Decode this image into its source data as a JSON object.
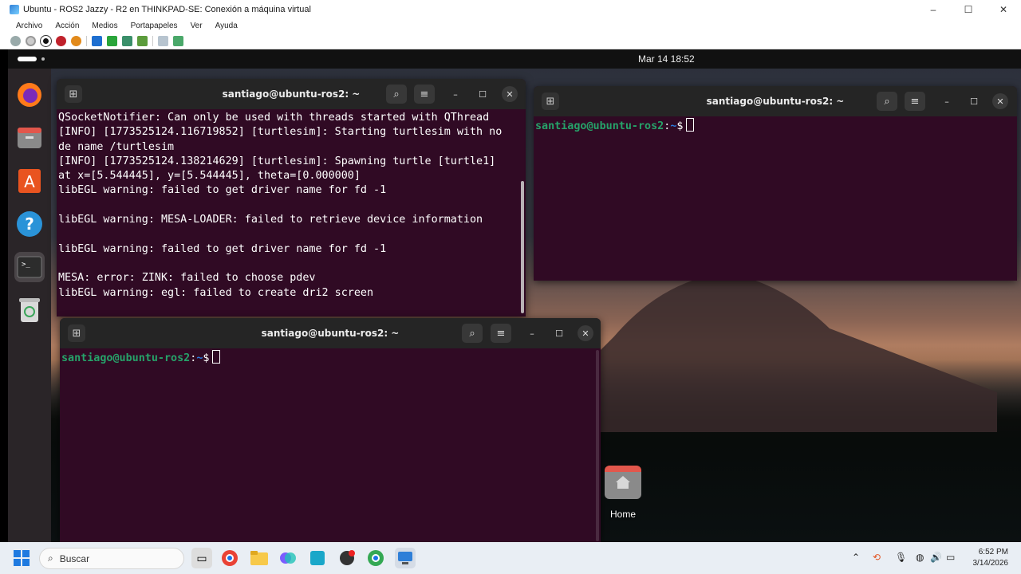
{
  "host": {
    "title": "Ubuntu - ROS2 Jazzy - R2 en THINKPAD-SE: Conexión a máquina virtual",
    "menu": [
      "Archivo",
      "Acción",
      "Medios",
      "Portapapeles",
      "Ver",
      "Ayuda"
    ],
    "window_controls": {
      "minimize": "–",
      "maximize": "☐",
      "close": "✕"
    }
  },
  "topbar": {
    "clock": "Mar 14  18:52"
  },
  "terminals": {
    "title": "santiago@ubuntu-ros2: ~",
    "t1_lines": [
      "QSocketNotifier: Can only be used with threads started with QThread",
      "[INFO] [1773525124.116719852] [turtlesim]: Starting turtlesim with no",
      "de name /turtlesim",
      "[INFO] [1773525124.138214629] [turtlesim]: Spawning turtle [turtle1]",
      "at x=[5.544445], y=[5.544445], theta=[0.000000]",
      "libEGL warning: failed to get driver name for fd -1",
      "",
      "libEGL warning: MESA-LOADER: failed to retrieve device information",
      "",
      "libEGL warning: failed to get driver name for fd -1",
      "",
      "MESA: error: ZINK: failed to choose pdev",
      "libEGL warning: egl: failed to create dri2 screen"
    ],
    "prompt_user": "santiago@ubuntu-ros2",
    "prompt_sep": ":",
    "prompt_path": "~",
    "prompt_sym": "$"
  },
  "desktop": {
    "home_label": "Home"
  },
  "taskbar": {
    "search_label": "Buscar",
    "time": "6:52 PM",
    "date": "3/14/2026"
  }
}
